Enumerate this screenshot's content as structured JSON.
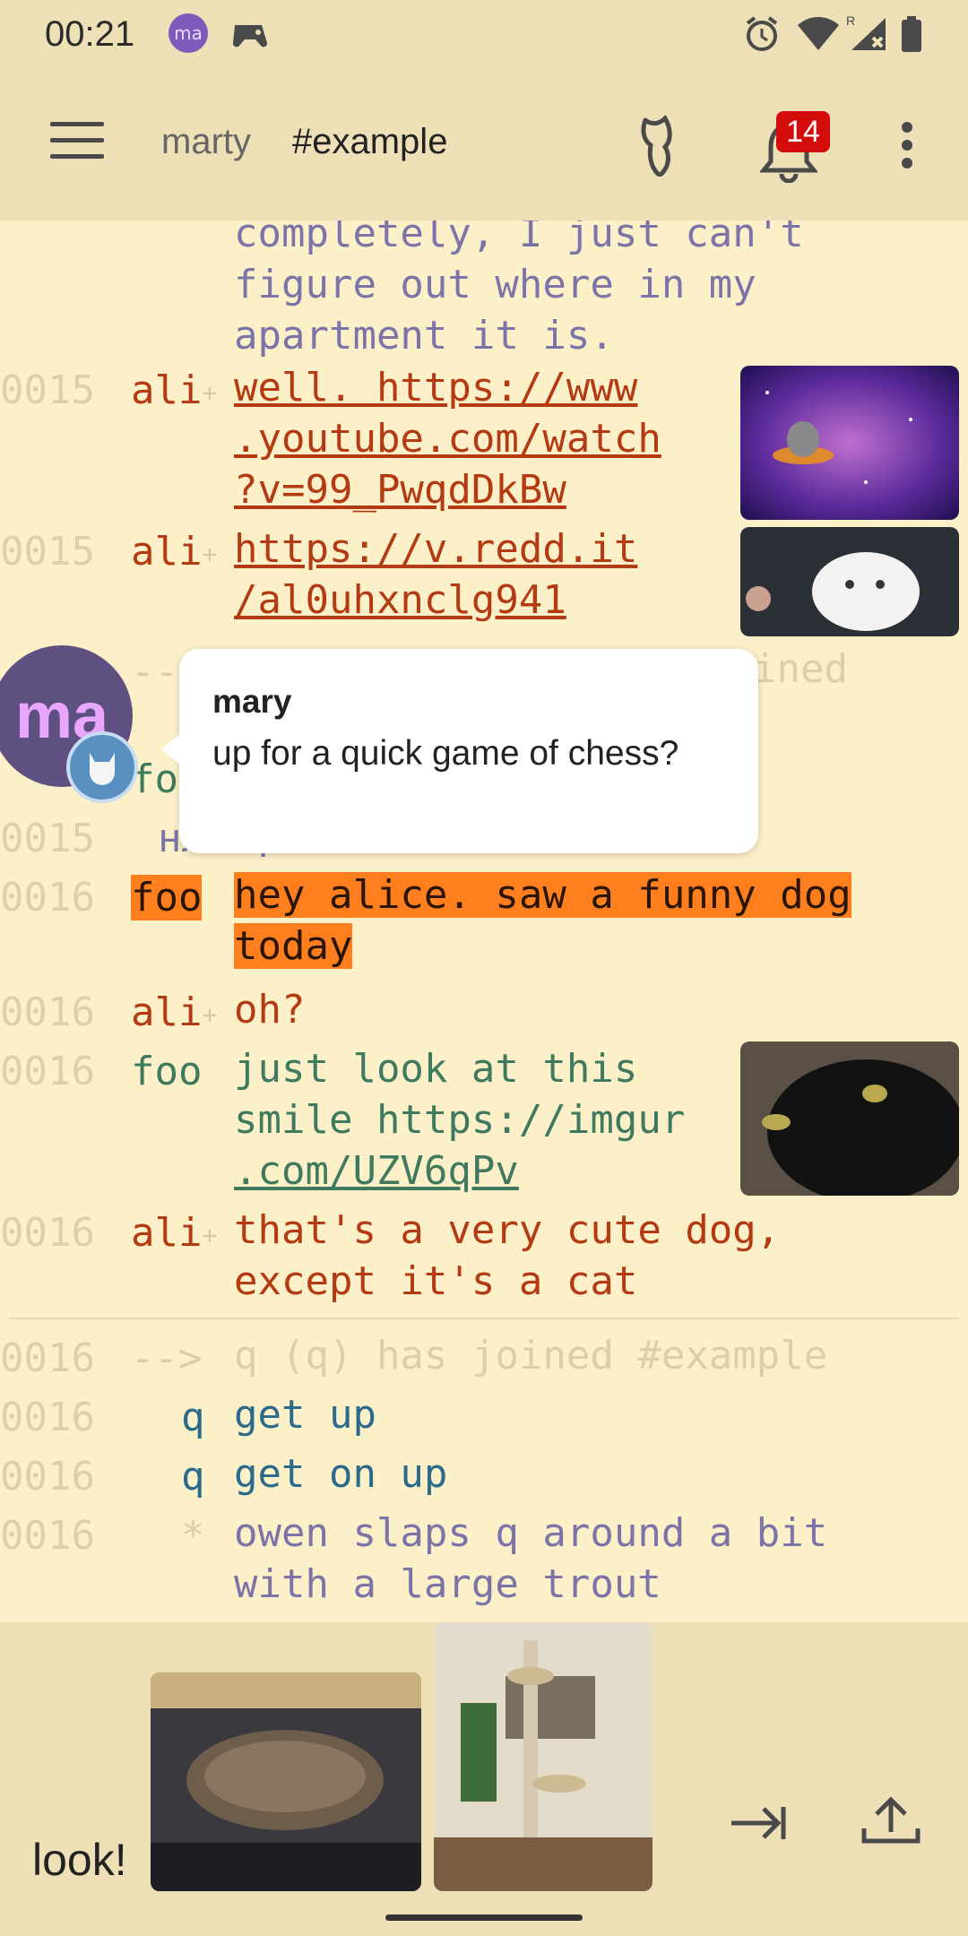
{
  "status_bar": {
    "time": "00:21",
    "avatar_initials": "ma",
    "icons": [
      "game-controller-icon",
      "alarm-icon",
      "wifi-icon",
      "signal-roaming-icon",
      "battery-icon"
    ]
  },
  "toolbar": {
    "network": "marty",
    "channel": "#example",
    "notification_count": "14",
    "icons": [
      "menu-icon",
      "dragon-icon",
      "bell-icon",
      "overflow-menu-icon"
    ]
  },
  "colors": {
    "background": "#fbf0c8",
    "bar": "#ede0b7",
    "nick_red": "#b33a12",
    "nick_green": "#3f7a5f",
    "highlight": "#ff7f1e",
    "badge": "#d40b0b"
  },
  "chat": {
    "partial_lines": [
      "completely, I just can't",
      "figure out where in my",
      "apartment it is."
    ],
    "messages": [
      {
        "ts": "0015",
        "nick": "ali",
        "lines": [
          "well. https://www",
          ".youtube.com/watch",
          "?v=99_PwqdDkBw"
        ]
      },
      {
        "ts": "0015",
        "nick": "ali",
        "lines": [
          "https://v.redd.it",
          "/al0uhxnclg941"
        ]
      },
      {
        "ts": "",
        "nick": "--",
        "lines": [
          "ined"
        ]
      },
      {
        "ts": "",
        "nick": "fo",
        "lines": [
          ""
        ]
      },
      {
        "ts": "0015",
        "nick": "нл",
        "lines": [
          "привет"
        ]
      },
      {
        "ts": "0016",
        "nick": "foo",
        "lines": [
          "hey alice. saw a funny dog",
          "today"
        ]
      },
      {
        "ts": "0016",
        "nick": "ali",
        "lines": [
          "oh?"
        ]
      },
      {
        "ts": "0016",
        "nick": "foo",
        "lines": [
          "just look at this",
          "smile https://imgur",
          ".com/UZV6qPv"
        ]
      },
      {
        "ts": "0016",
        "nick": "ali",
        "lines": [
          "that's a very cute dog,",
          "except it's a cat"
        ]
      },
      {
        "ts": "0016",
        "nick": "-->",
        "lines": [
          "q (q) has joined #example"
        ]
      },
      {
        "ts": "0016",
        "nick": "q",
        "lines": [
          "get up"
        ]
      },
      {
        "ts": "0016",
        "nick": "q",
        "lines": [
          "get on up"
        ]
      },
      {
        "ts": "0016",
        "nick": "*",
        "lines": [
          "owen slaps q around a bit",
          "with a large trout"
        ]
      }
    ]
  },
  "popup": {
    "sender": "mary",
    "text": "up for a quick game of chess?",
    "avatar_initials": "ma"
  },
  "input": {
    "text": "look!"
  }
}
